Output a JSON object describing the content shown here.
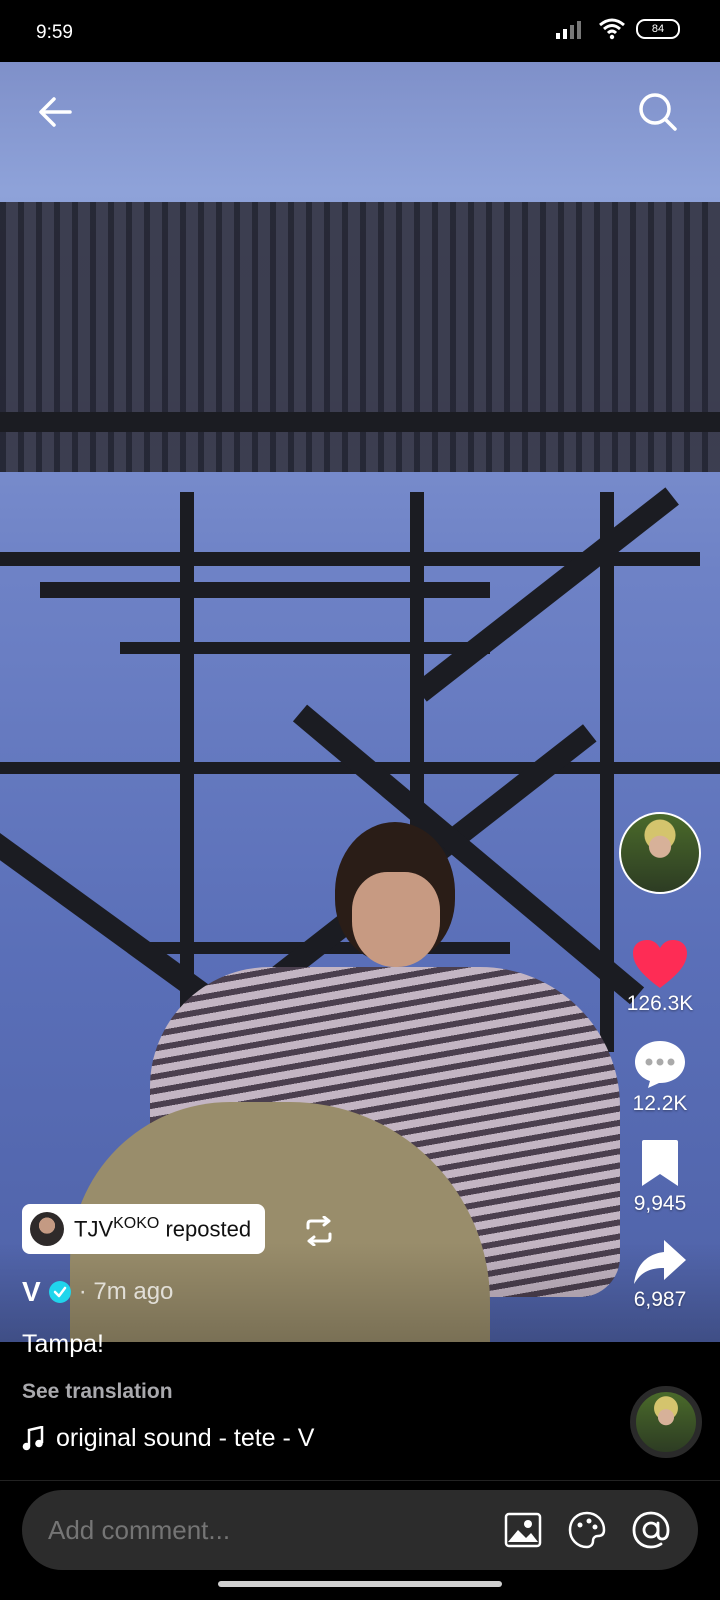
{
  "status_bar": {
    "time": "9:59",
    "battery": "84"
  },
  "repost": {
    "user": "TJV",
    "user_superscript": "KOKO",
    "suffix": "reposted"
  },
  "post": {
    "author": "V",
    "time_ago": "· 7m ago",
    "caption": "Tampa!",
    "see_translation": "See translation"
  },
  "sound": {
    "label": "original sound - tete - V"
  },
  "actions": {
    "likes": "126.3K",
    "comments": "12.2K",
    "saves": "9,945",
    "shares": "6,987"
  },
  "comment_bar": {
    "placeholder": "Add comment..."
  },
  "icons": {
    "back": "arrow-left-icon",
    "search": "search-icon",
    "like": "heart-icon",
    "comment": "comment-bubble-icon",
    "save": "bookmark-icon",
    "share": "share-arrow-icon",
    "repost": "repost-icon",
    "music": "music-note-icon",
    "image": "image-icon",
    "emoji": "emoji-icon",
    "mention": "at-sign-icon"
  },
  "colors": {
    "like": "#fe2c55",
    "verified": "#20d5ec"
  }
}
